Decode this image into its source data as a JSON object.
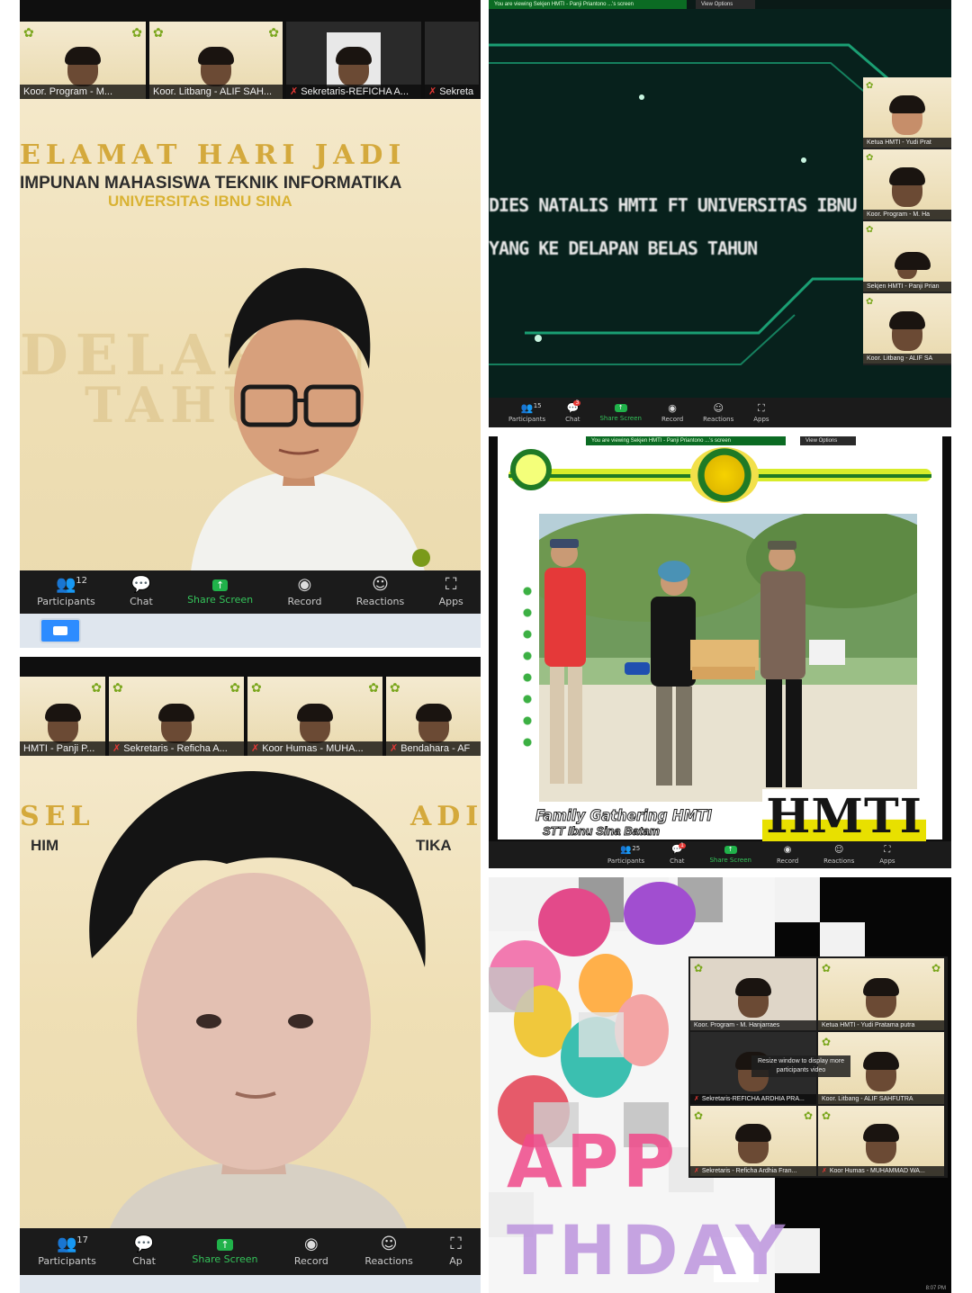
{
  "panel1": {
    "thumbs": [
      {
        "name": "Koor. Program - M...",
        "mic_muted": false
      },
      {
        "name": "Koor. Litbang - ALIF SAH...",
        "mic_muted": false
      },
      {
        "name": "Sekretaris-REFICHA A...",
        "mic_muted": true
      },
      {
        "name": "Sekreta",
        "mic_muted": true
      }
    ],
    "title": "ELAMAT HARI JADI",
    "subtitle": "IMPUNAN MAHASISWA TEKNIK INFORMATIKA",
    "university": "UNIVERSITAS IBNU SINA",
    "ghost_text_1": "DELAPAN",
    "ghost_text_2": "TAHUN",
    "toolbar": {
      "participants_count": "12",
      "participants": "Participants",
      "chat": "Chat",
      "share": "Share Screen",
      "record": "Record",
      "reactions": "Reactions",
      "apps": "Apps"
    }
  },
  "panel2": {
    "banner": "You are viewing Sekjen HMTI - Panji Priantono ...'s screen",
    "view_options": "View Options",
    "screen_line_1": "DIES NATALIS HMTI FT UNIVERSITAS IBNU SINA",
    "screen_line_2": "YANG KE DELAPAN BELAS TAHUN",
    "thumbs": [
      {
        "name": "Ketua HMTI - Yudi Prat"
      },
      {
        "name": "Koor. Program - M. Ha"
      },
      {
        "name": "Sekjen HMTI - Panji Prian"
      },
      {
        "name": "Koor. Litbang - ALIF SA"
      }
    ],
    "toolbar": {
      "participants_count": "15",
      "chat_badge": "3",
      "participants": "Participants",
      "chat": "Chat",
      "share": "Share Screen",
      "record": "Record",
      "reactions": "Reactions",
      "apps": "Apps"
    }
  },
  "panel3": {
    "banner": "You are viewing Sekjen HMTI - Panji Priantono ...'s screen",
    "view_options": "View Options",
    "caption_1": "Family Gathering HMTI",
    "caption_2": "STT Ibnu Sina Batam",
    "org": "HMTI",
    "toolbar": {
      "participants_count": "25",
      "chat_badge": "1",
      "participants": "Participants",
      "chat": "Chat",
      "share": "Share Screen",
      "record": "Record",
      "reactions": "Reactions",
      "apps": "Apps"
    }
  },
  "panel4": {
    "thumbs": [
      {
        "name": "HMTI - Panji P...",
        "mic_muted": false
      },
      {
        "name": "Sekretaris - Reficha A...",
        "mic_muted": true
      },
      {
        "name": "Koor Humas - MUHA...",
        "mic_muted": true
      },
      {
        "name": "Bendahara - AF",
        "mic_muted": true
      }
    ],
    "title_left": "SEL",
    "title_right": "ADI",
    "subtitle_left": "HIM",
    "subtitle_right": "TIKA",
    "toolbar": {
      "participants_count": "17",
      "participants": "Participants",
      "chat": "Chat",
      "share": "Share Screen",
      "record": "Record",
      "reactions": "Reactions",
      "apps": "Ap"
    }
  },
  "panel5": {
    "grid": [
      {
        "name": "Koor. Program - M. Hanjarraes",
        "mic_muted": false
      },
      {
        "name": "Ketua HMTI - Yudi Pratama putra",
        "mic_muted": false
      },
      {
        "name": "Sekretaris-REFICHA ARDHIA PRA...",
        "mic_muted": true
      },
      {
        "name": "Koor. Litbang - ALIF SAHFUTRA",
        "mic_muted": false
      },
      {
        "name": "Sekretaris - Reficha Ardhia Fran...",
        "mic_muted": true
      },
      {
        "name": "Koor Humas - MUHAMMAD WA...",
        "mic_muted": true
      }
    ],
    "tooltip": "Resize window to display more participants video",
    "bg_word_1": "APP",
    "bg_word_2": "THDAY",
    "time": "8:07 PM"
  }
}
